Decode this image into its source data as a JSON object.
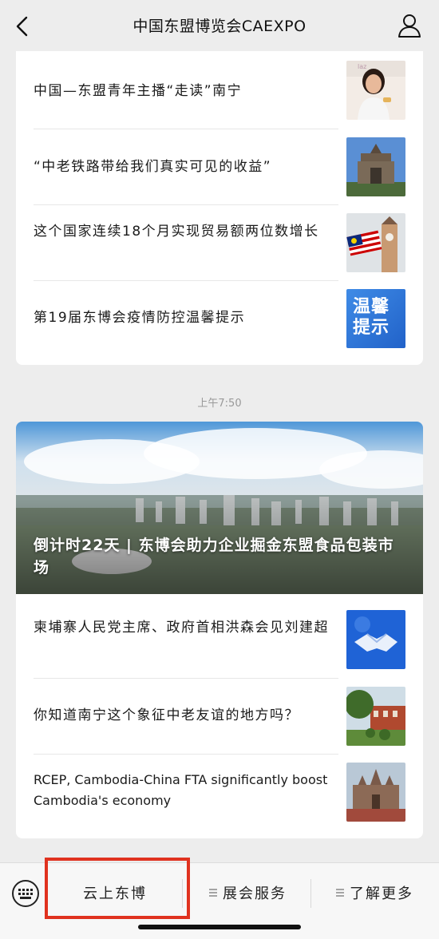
{
  "header": {
    "title": "中国东盟博览会CAEXPO",
    "back_icon": "chevron-left-icon",
    "profile_icon": "user-icon"
  },
  "group1": {
    "items": [
      {
        "title": "中国—东盟青年主播“走读”南宁",
        "thumb": "anchor-photo"
      },
      {
        "title": "“中老铁路带给我们真实可见的收益”",
        "thumb": "monument-photo"
      },
      {
        "title": "这个国家连续18个月实现贸易额两位数增长",
        "thumb": "flag-clocktower-photo"
      },
      {
        "title": "第19届东博会疫情防控温馨提示",
        "thumb_text": "温馨提示"
      }
    ]
  },
  "timestamp": "上午7:50",
  "group2": {
    "hero_title": "倒计时22天 | 东博会助力企业掘金东盟食品包装市场",
    "items": [
      {
        "title": "柬埔寨人民党主席、政府首相洪森会见刘建超",
        "thumb": "handshake-photo"
      },
      {
        "title": "你知道南宁这个象征中老友谊的地方吗？",
        "thumb": "garden-photo"
      },
      {
        "title": "RCEP, Cambodia-China FTA significantly boost Cambodia's economy",
        "thumb": "temple-photo"
      }
    ]
  },
  "bottom_menu": {
    "keyboard_icon": "keyboard-icon",
    "items": [
      {
        "label": "云上东博"
      },
      {
        "label": "展会服务"
      },
      {
        "label": "了解更多"
      }
    ]
  },
  "colors": {
    "highlight": "#e0321f",
    "accent": "#1e6fd9"
  }
}
